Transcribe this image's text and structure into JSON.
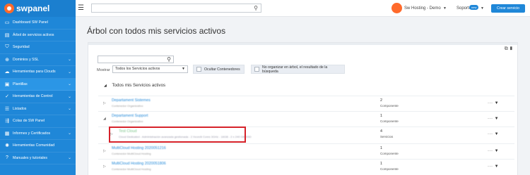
{
  "app": {
    "brand": "swpanel"
  },
  "sidebar": {
    "items": [
      {
        "label": "Dashboard SW Panel",
        "icon": "dashboard-icon",
        "glyph": "▭",
        "has_submenu": false
      },
      {
        "label": "Árbol de servicios activos",
        "icon": "tree-icon",
        "glyph": "▤",
        "has_submenu": false
      },
      {
        "label": "Seguridad",
        "icon": "shield-icon",
        "glyph": "⛉",
        "has_submenu": false
      },
      {
        "label": "Dominios y SSL",
        "icon": "globe-icon",
        "glyph": "⊕",
        "has_submenu": true
      },
      {
        "label": "Herramientas para Clouds",
        "icon": "cloud-icon",
        "glyph": "☁",
        "has_submenu": true
      },
      {
        "label": "Plantillas",
        "icon": "template-icon",
        "glyph": "▣",
        "has_submenu": true
      },
      {
        "label": "Herramientas de Control",
        "icon": "check-circle-icon",
        "glyph": "✓",
        "has_submenu": true
      },
      {
        "label": "Listados",
        "icon": "list-icon",
        "glyph": "☰",
        "has_submenu": true
      },
      {
        "label": "Colas de SW Panel",
        "icon": "queue-icon",
        "glyph": "⇶",
        "has_submenu": false
      },
      {
        "label": "Informes y Certificados",
        "icon": "report-icon",
        "glyph": "▦",
        "has_submenu": true
      },
      {
        "label": "Herramientas Comunidad",
        "icon": "community-icon",
        "glyph": "✺",
        "has_submenu": false
      },
      {
        "label": "Manuales y tutoriales",
        "icon": "help-icon",
        "glyph": "?",
        "has_submenu": true
      }
    ]
  },
  "topbar": {
    "search_value": "",
    "user_name": "Sw Hosting - Demo",
    "support_label": "Soporte",
    "support_badge": "new",
    "create_button": "Crear servicio"
  },
  "page": {
    "title": "Árbol con todos mis servicios activos"
  },
  "filters": {
    "search_value": "",
    "show_label": "Mostrar",
    "show_selected": "Todos los Servicios activos",
    "hide_containers": "Ocultar Contenedores",
    "no_tree": "No organizar en árbol, el resultado de la búsqueda"
  },
  "tree": {
    "root_label": "Todos mis Servicios activos",
    "rows": [
      {
        "title": "Departament Sistemes",
        "subtitle": "Contenedor Organizativo",
        "count": "2",
        "count_label": "Componente",
        "expanded": false,
        "child": false
      },
      {
        "title": "Departament Support",
        "subtitle": "Contenedor Organizativo",
        "count": "1",
        "count_label": "Componente",
        "expanded": true,
        "child": false
      },
      {
        "title": "Test Cloud",
        "subtitle": "Cloud Dedicated - Administración avanzada gestionada - 2 Xeon/8 Cores 3GHz - 16GB - 2 x 240 GB SSD",
        "count": "4",
        "count_label": "Servicios",
        "expanded": false,
        "child": true
      },
      {
        "title": "MultiCloud Hosting 2020051216",
        "subtitle": "Contenedor MultiCloud Hosting",
        "count": "1",
        "count_label": "Componente",
        "expanded": false,
        "child": false
      },
      {
        "title": "MultiCloud Hosting 2020051806",
        "subtitle": "Contenedor MultiCloud Hosting",
        "count": "1",
        "count_label": "Componente",
        "expanded": false,
        "child": false
      }
    ]
  }
}
